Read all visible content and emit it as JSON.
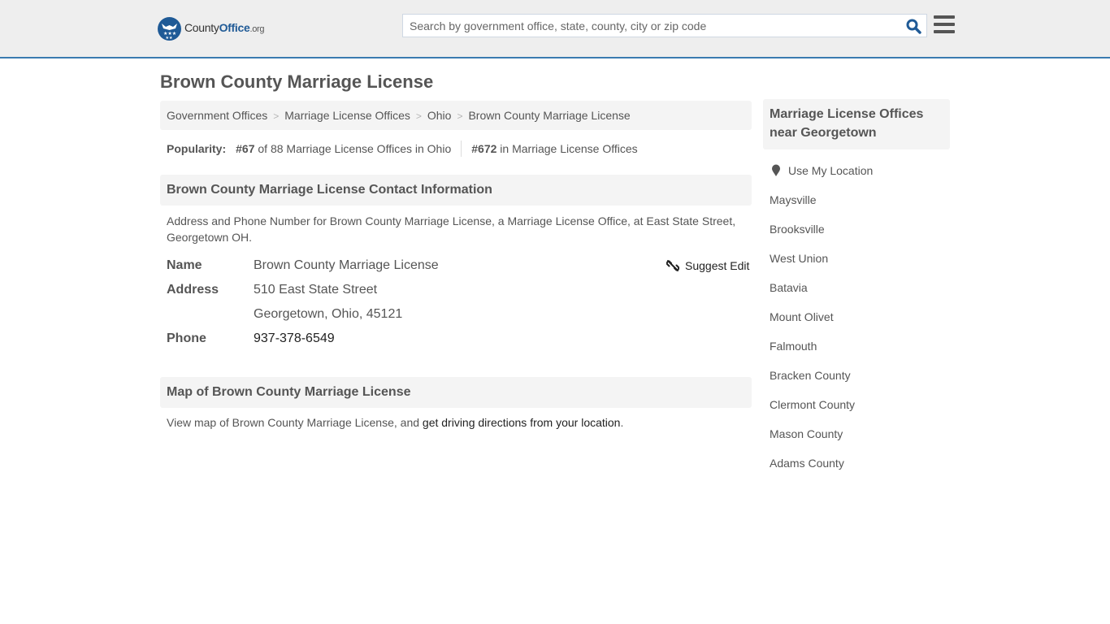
{
  "header": {
    "logo": {
      "county": "County",
      "office": "Office",
      "org": ".org",
      "icon": "eagle-badge-icon"
    },
    "search": {
      "placeholder": "Search by government office, state, county, city or zip code",
      "value": "",
      "icon": "search-icon"
    },
    "menu_icon": "hamburger-menu-icon",
    "accent_color": "#3a7bb0"
  },
  "page": {
    "title": "Brown County Marriage License"
  },
  "breadcrumb": {
    "items": [
      {
        "label": "Government Offices"
      },
      {
        "label": "Marriage License Offices"
      },
      {
        "label": "Ohio"
      },
      {
        "label": "Brown County Marriage License"
      }
    ],
    "separator": ">"
  },
  "popularity": {
    "label": "Popularity:",
    "state_rank": "#67",
    "state_text": "of 88 Marriage License Offices in Ohio",
    "national_rank": "#672",
    "national_text": "in Marriage License Offices"
  },
  "contact": {
    "heading": "Brown County Marriage License Contact Information",
    "description": "Address and Phone Number for Brown County Marriage License, a Marriage License Office, at East State Street, Georgetown OH.",
    "suggest_edit": "Suggest Edit",
    "suggest_edit_icon": "unlink-icon",
    "fields": {
      "name_label": "Name",
      "name_value": "Brown County Marriage License",
      "address_label": "Address",
      "address_line1": "510 East State Street",
      "address_line2": "Georgetown, Ohio, 45121",
      "phone_label": "Phone",
      "phone_value": "937-378-6549"
    }
  },
  "map": {
    "heading": "Map of Brown County Marriage License",
    "text_before": "View map of Brown County Marriage License, and ",
    "link": "get driving directions from your location",
    "text_after": "."
  },
  "sidebar": {
    "heading": "Marriage License Offices near Georgetown",
    "use_location": "Use My Location",
    "location_icon": "map-pin-icon",
    "items": [
      {
        "label": "Maysville"
      },
      {
        "label": "Brooksville"
      },
      {
        "label": "West Union"
      },
      {
        "label": "Batavia"
      },
      {
        "label": "Mount Olivet"
      },
      {
        "label": "Falmouth"
      },
      {
        "label": "Bracken County"
      },
      {
        "label": "Clermont County"
      },
      {
        "label": "Mason County"
      },
      {
        "label": "Adams County"
      }
    ]
  }
}
